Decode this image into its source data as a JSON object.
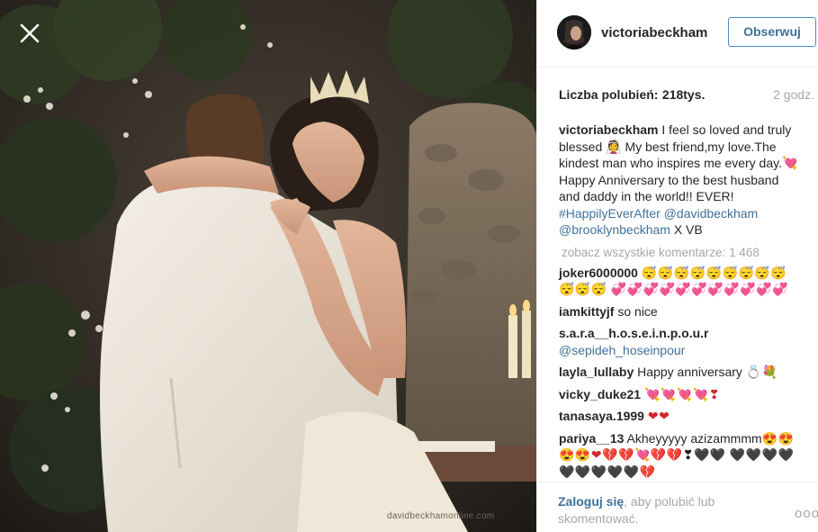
{
  "post": {
    "username": "victoriabeckham",
    "follow_label": "Obserwuj",
    "likes_label": "Liczba polubień:",
    "likes_count": "218tys.",
    "time_ago": "2 godz.",
    "caption": {
      "username": "victoriabeckham",
      "text_1": " I feel so loved and truly blessed ",
      "emoji_1": "👰",
      "text_2": " My best friend,my love.The kindest man who inspires me every day.",
      "emoji_2": "💘",
      "text_3": " Happy Anniversary to the best husband and daddy in the world!! EVER! ",
      "hashtag": "#HappilyEverAfter",
      "mention_1": "@davidbeckham",
      "mention_2": "@brooklynbeckham",
      "text_4": " X VB"
    },
    "view_all_comments": "zobacz wszystkie komentarze: 1 468"
  },
  "comments": [
    {
      "username": "joker6000000",
      "text": "",
      "emoji_a": "😴😴😴😴😴😴😴😴😴😴😴😴",
      "emoji_b": "💞💞💞💞💞💞💞💞💞💞💞"
    },
    {
      "username": "iamkittyjf",
      "text": "so nice"
    },
    {
      "username": "s.a.r.a__h.o.s.e.i.n.p.o.u.r",
      "mention": "@sepideh_hoseinpour"
    },
    {
      "username": "layla_lullaby",
      "text": "Happy anniversary",
      "emoji_a": "💍💐"
    },
    {
      "username": "vicky_duke21",
      "emoji_a": "💘💘💘💘❣"
    },
    {
      "username": "tanasaya.1999",
      "emoji_a": "❤❤"
    },
    {
      "username": "pariya__13",
      "text": "Akheyyyyy azizammmm",
      "emoji_a": "😍😍😍😍❤💔💔💘💔💔",
      "emoji_b": "❣🖤🖤",
      "emoji_c": "🖤🖤🖤🖤🖤🖤🖤🖤🖤💔"
    }
  ],
  "footer": {
    "login_link": "Zaloguj się",
    "login_rest": ", aby polubić lub skomentować.",
    "more_label": "ooo"
  },
  "photo": {
    "watermark": "davidbeckhamonline.com"
  },
  "colors": {
    "link": "#3f729b",
    "follow_border": "#4f8ac9",
    "muted": "#a5a7aa",
    "text": "#262626"
  },
  "icons": {
    "close": "close-icon",
    "more": "more-options-icon"
  }
}
